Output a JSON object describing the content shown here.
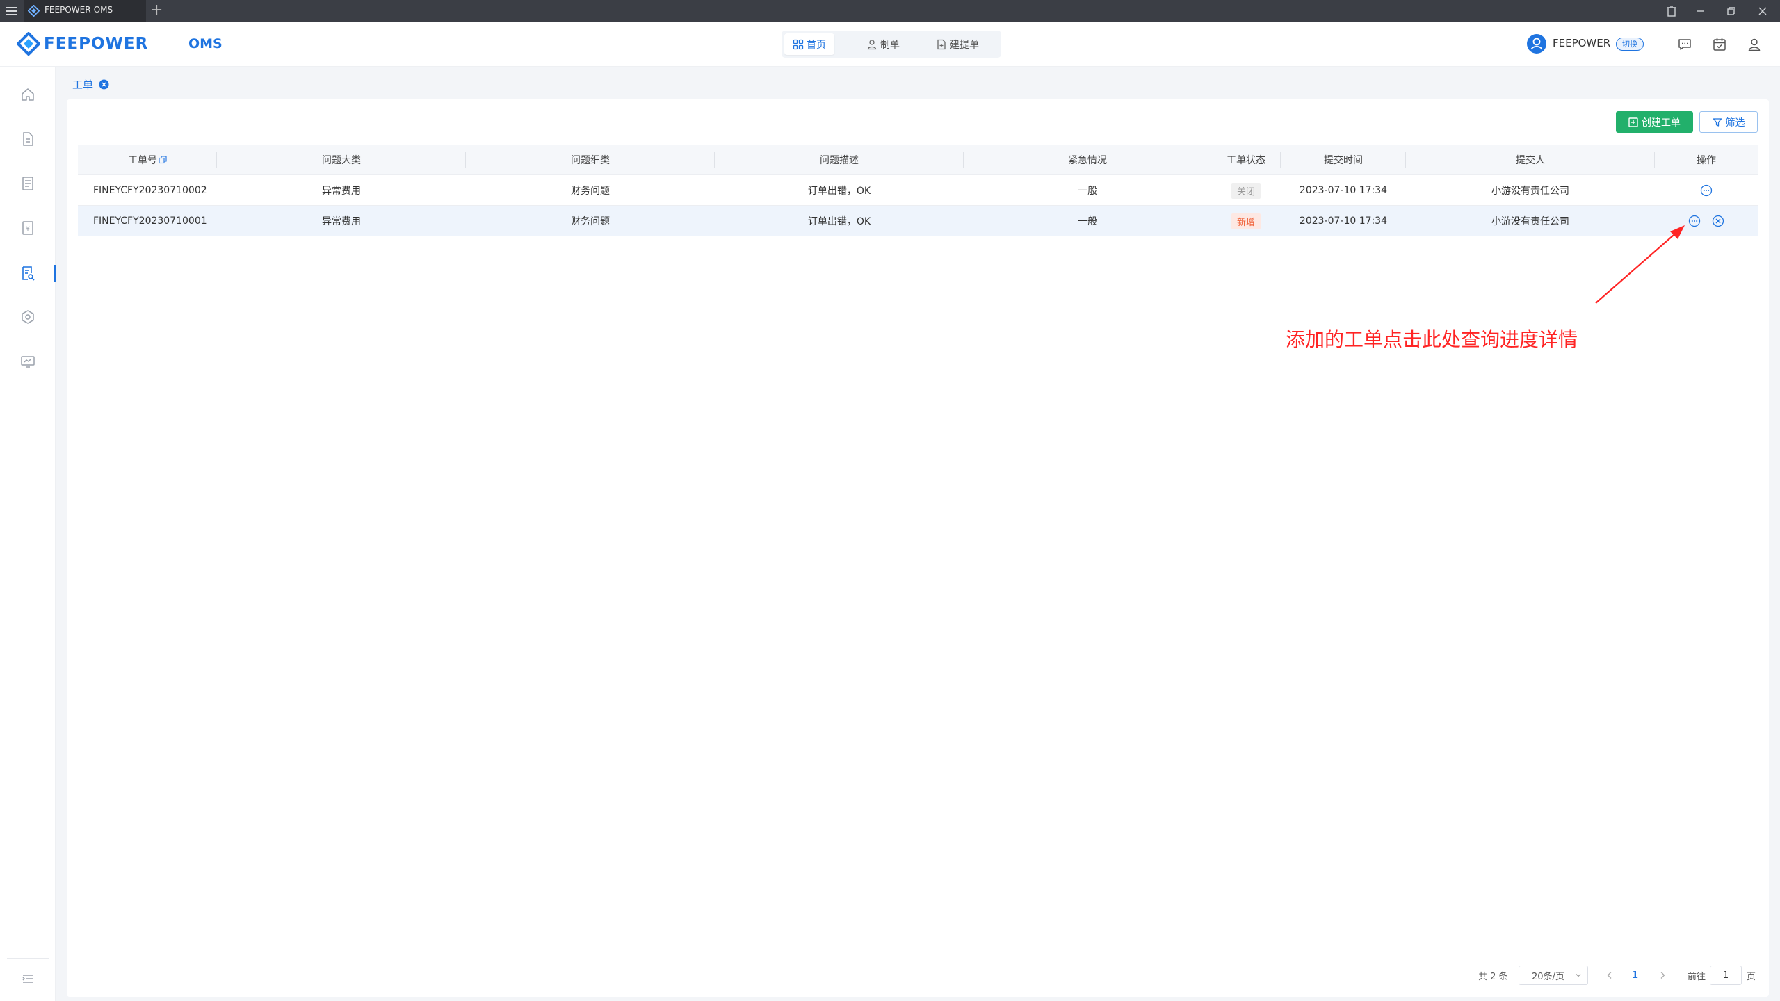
{
  "window": {
    "tab_title": "FEEPOWER-OMS",
    "new_tab": "+"
  },
  "header": {
    "brand": "FEEPOWER",
    "product": "OMS",
    "nav": [
      {
        "label": "首页",
        "icon": "grid-icon",
        "active": true
      },
      {
        "label": "制单",
        "icon": "user-doc-icon",
        "active": false
      },
      {
        "label": "建提单",
        "icon": "file-add-icon",
        "active": false
      }
    ],
    "user_name": "FEEPOWER",
    "switch_label": "切换",
    "icons": [
      "message-icon",
      "calendar-check-icon",
      "user-icon"
    ]
  },
  "sidebar": {
    "items": [
      "home-icon",
      "document-icon",
      "list-document-icon",
      "invoice-icon",
      "work-order-icon",
      "settings-hexagon-icon",
      "monitor-icon"
    ],
    "active_index": 4,
    "bottom": "menu-collapse-icon"
  },
  "page_tag": {
    "label": "工单"
  },
  "toolbar": {
    "create_label": "创建工单",
    "filter_label": "筛选"
  },
  "table": {
    "columns": [
      "工单号",
      "问题大类",
      "问题细类",
      "问题描述",
      "紧急情况",
      "工单状态",
      "提交时间",
      "提交人",
      "操作"
    ],
    "rows": [
      {
        "order_no": "FINEYCFY20230710002",
        "category": "异常费用",
        "subcategory": "财务问题",
        "description": "订单出错，OK",
        "urgency": "一般",
        "status": "关闭",
        "status_type": "closed",
        "submit_time": "2023-07-10 17:34",
        "submitter": "小游没有责任公司",
        "actions": [
          "view-detail-icon"
        ]
      },
      {
        "order_no": "FINEYCFY20230710001",
        "category": "异常费用",
        "subcategory": "财务问题",
        "description": "订单出错，OK",
        "urgency": "一般",
        "status": "新增",
        "status_type": "new",
        "submit_time": "2023-07-10 17:34",
        "submitter": "小游没有责任公司",
        "actions": [
          "view-detail-icon",
          "cancel-icon"
        ]
      }
    ]
  },
  "annotation": {
    "text": "添加的工单点击此处查询进度详情",
    "color": "#ff2424"
  },
  "pagination": {
    "total": "共 2 条",
    "page_size": "20条/页",
    "current_page": "1",
    "goto_label": "前往",
    "goto_value": "1",
    "page_suffix": "页"
  },
  "colors": {
    "primary": "#1f74e0",
    "success": "#22b06b",
    "danger": "#f0623a"
  }
}
